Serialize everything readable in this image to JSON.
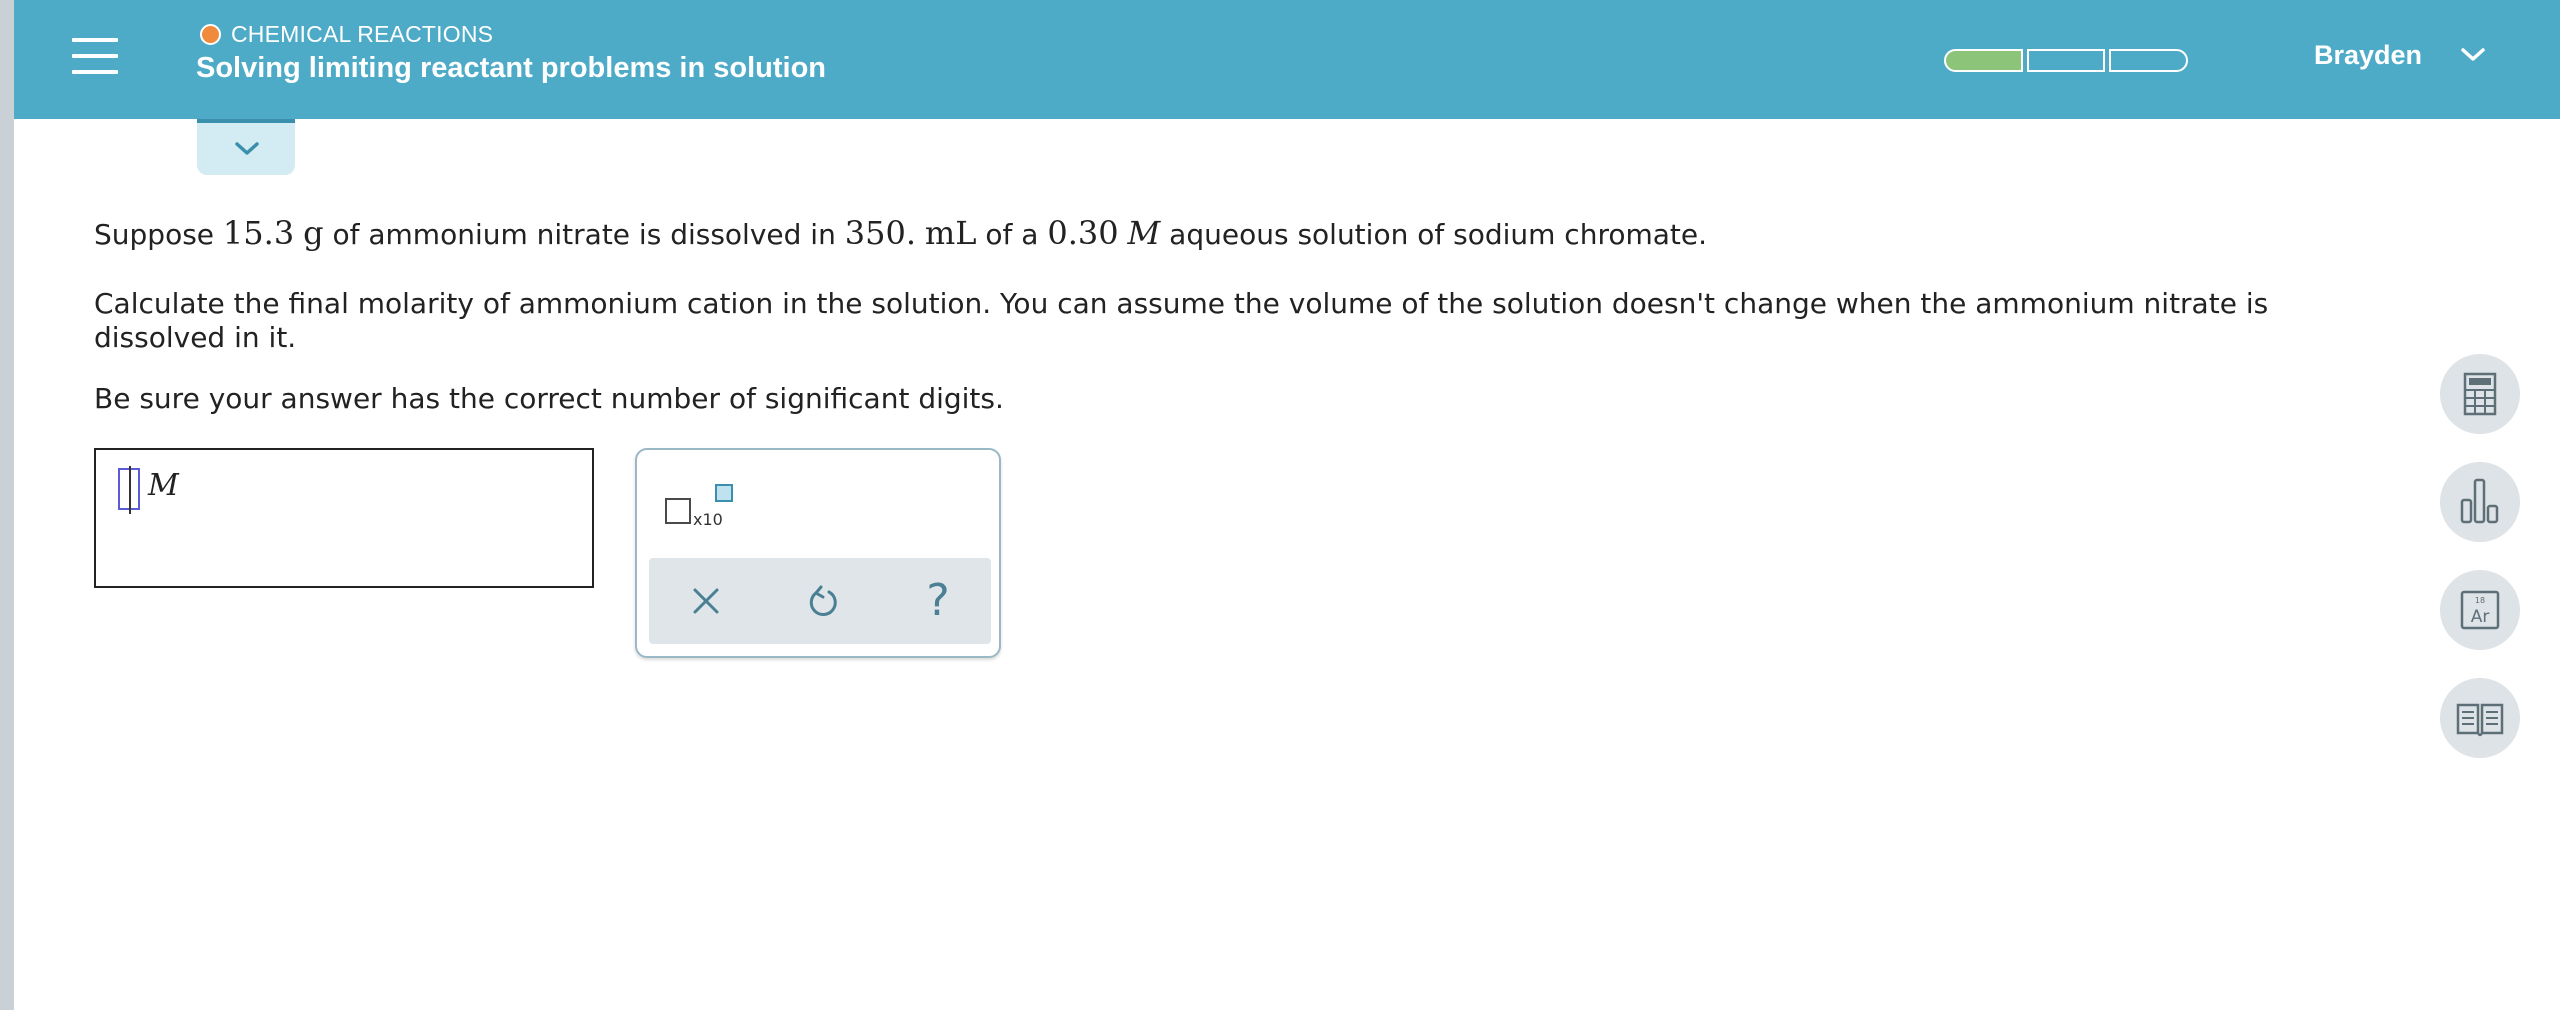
{
  "header": {
    "topic": "CHEMICAL REACTIONS",
    "title": "Solving limiting reactant problems in solution",
    "progress_filled_segments": 1,
    "progress_total_segments": 3,
    "user_name": "Brayden",
    "colors": {
      "bar": "#4eabc8",
      "topic_dot": "#f08a3c",
      "progress_fill": "#8cc47a"
    }
  },
  "question": {
    "line1": {
      "t1": "Suppose",
      "mass": "15.3",
      "mass_unit": "g",
      "t2": "of ammonium nitrate is dissolved in",
      "volume": "350.",
      "volume_unit": "mL",
      "t3": "of a",
      "conc": "0.30",
      "conc_unit": "M",
      "t4": "aqueous solution of sodium chromate."
    },
    "line2": "Calculate the final molarity of ammonium cation in the solution. You can assume the volume of the solution doesn't change when the ammonium nitrate is dissolved in it.",
    "line3": "Be sure your answer has the correct number of significant digits."
  },
  "answer": {
    "value": "",
    "unit": "M"
  },
  "toolbox": {
    "sci_notation_label": "x10",
    "help_glyph": "?",
    "icons": [
      "scientific-notation-icon",
      "clear-icon",
      "undo-icon",
      "help-icon"
    ]
  },
  "side_tools": {
    "icons": [
      "calculator-icon",
      "bar-chart-icon",
      "periodic-table-icon",
      "textbook-icon"
    ],
    "periodic_number": "18",
    "periodic_symbol": "Ar"
  }
}
